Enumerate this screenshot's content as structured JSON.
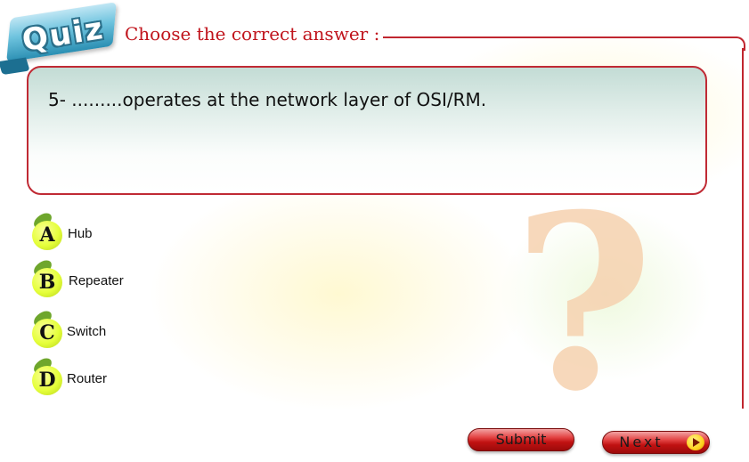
{
  "header": {
    "badge_text": "Quiz",
    "instruction": "Choose the correct answer :"
  },
  "question": {
    "text": "5- .........operates at the network layer of OSI/RM."
  },
  "options": [
    {
      "letter": "A",
      "label": "Hub"
    },
    {
      "letter": "B",
      "label": "Repeater"
    },
    {
      "letter": "C",
      "label": "Switch"
    },
    {
      "letter": "D",
      "label": "Router"
    }
  ],
  "buttons": {
    "submit": "Submit",
    "next": "Next"
  },
  "decoration": {
    "symbol": "?",
    "colors": {
      "accent_red": "#c0141c",
      "badge_blue": "#2b8fb3",
      "option_yellow": "#e5ff3a",
      "question_mark": "#f6d2b0"
    }
  },
  "icons": {
    "next_arrow": "play-arrow-icon"
  }
}
